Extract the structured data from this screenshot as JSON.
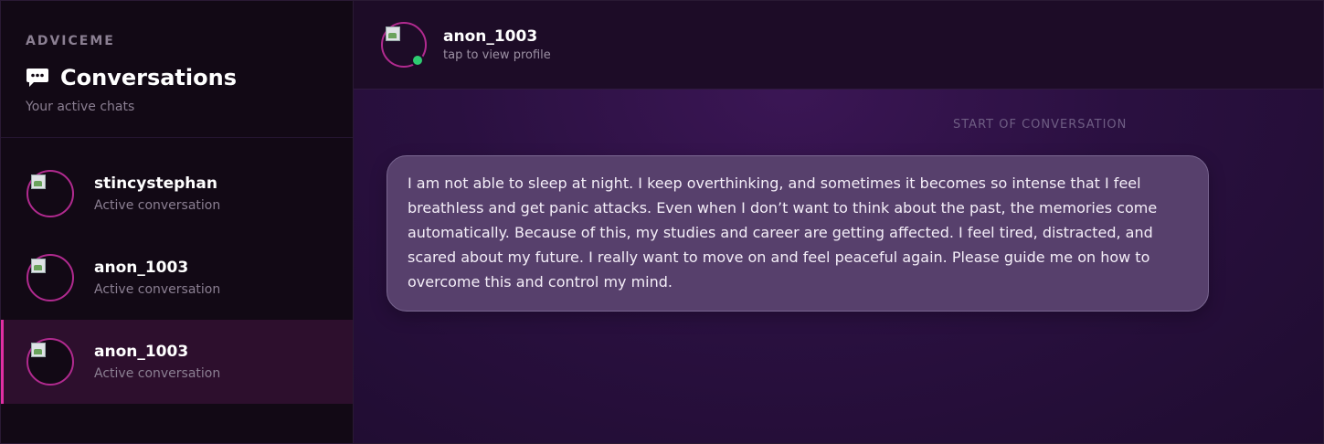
{
  "sidebar": {
    "brand": "ADVICEME",
    "title": "Conversations",
    "subtitle": "Your active chats",
    "items": [
      {
        "name": "stincystephan",
        "status": "Active conversation",
        "active": false
      },
      {
        "name": "anon_1003",
        "status": "Active conversation",
        "active": false
      },
      {
        "name": "anon_1003",
        "status": "Active conversation",
        "active": true
      }
    ]
  },
  "header": {
    "name": "anon_1003",
    "subtitle": "tap to view profile",
    "online": true
  },
  "chat": {
    "start_label": "START OF CONVERSATION",
    "messages": [
      {
        "text": "I am not able to sleep at night. I keep overthinking, and sometimes it becomes so intense that I feel breathless and get panic attacks. Even when I don’t want to think about the past, the memories come automatically. Because of this, my studies and career are getting affected. I feel tired, distracted, and scared about my future. I really want to move on and feel peaceful again. Please guide me on how to overcome this and control my mind."
      }
    ]
  },
  "colors": {
    "accent": "#e02fa3",
    "online": "#2ecc71",
    "bubble": "#57406c"
  },
  "icons": {
    "title_icon": "chat-bubble-icon"
  }
}
